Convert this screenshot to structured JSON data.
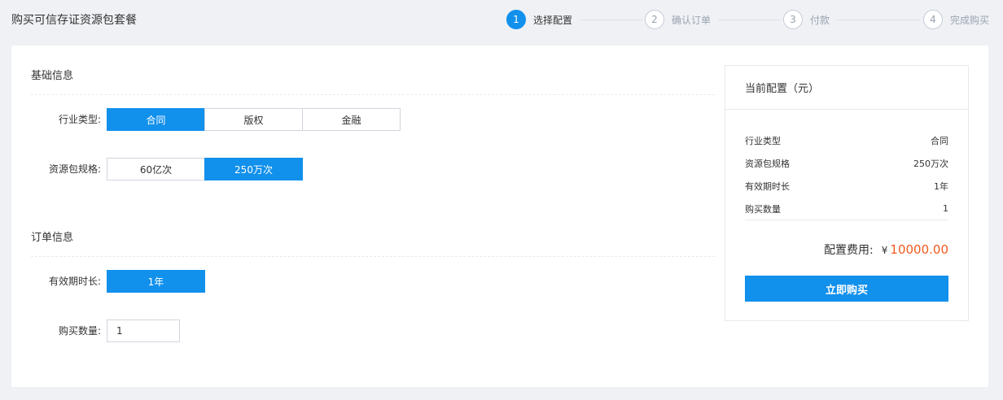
{
  "page": {
    "title": "购买可信存证资源包套餐"
  },
  "steps": [
    {
      "num": "1",
      "label": "选择配置",
      "active": true
    },
    {
      "num": "2",
      "label": "确认订单",
      "active": false
    },
    {
      "num": "3",
      "label": "付款",
      "active": false
    },
    {
      "num": "4",
      "label": "完成购买",
      "active": false
    }
  ],
  "basic_info": {
    "title": "基础信息",
    "industry": {
      "label": "行业类型:",
      "options": [
        "合同",
        "版权",
        "金融"
      ],
      "selected": "合同"
    },
    "spec": {
      "label": "资源包规格:",
      "options": [
        "60亿次",
        "250万次"
      ],
      "selected": "250万次"
    }
  },
  "order_info": {
    "title": "订单信息",
    "duration": {
      "label": "有效期时长:",
      "options": [
        "1年"
      ],
      "selected": "1年"
    },
    "quantity": {
      "label": "购买数量:",
      "value": "1"
    }
  },
  "summary": {
    "title": "当前配置（元）",
    "rows": [
      {
        "key": "行业类型",
        "value": "合同"
      },
      {
        "key": "资源包规格",
        "value": "250万次"
      },
      {
        "key": "有效期时长",
        "value": "1年"
      },
      {
        "key": "购买数量",
        "value": "1"
      }
    ],
    "fee_label": "配置费用:",
    "currency": "¥",
    "fee_value": "10000.00",
    "buy_label": "立即购买"
  },
  "colors": {
    "accent": "#1190ec",
    "price": "#f05a1f",
    "background": "#eff1f5"
  }
}
